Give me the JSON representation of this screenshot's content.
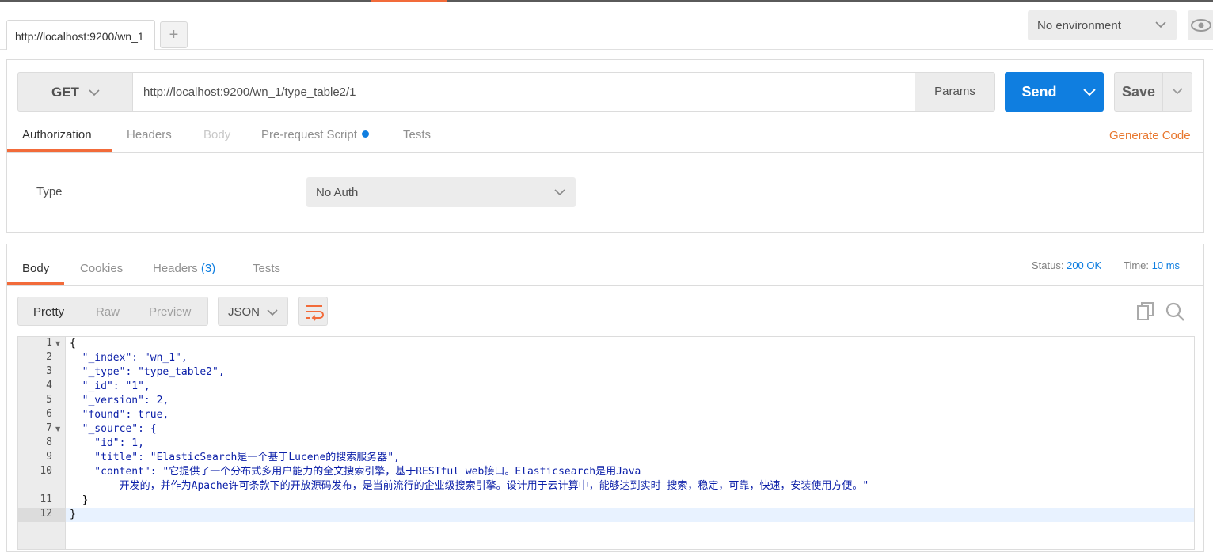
{
  "tabs": {
    "active_label": "http://localhost:9200/wn_1",
    "add_label": "+"
  },
  "environment": {
    "selected": "No environment"
  },
  "request": {
    "method": "GET",
    "url": "http://localhost:9200/wn_1/type_table2/1",
    "params_label": "Params",
    "send_label": "Send",
    "save_label": "Save",
    "tabs": [
      "Authorization",
      "Headers",
      "Body",
      "Pre-request Script",
      "Tests"
    ],
    "generate_code_label": "Generate Code",
    "auth_type_label": "Type",
    "auth_type_value": "No Auth"
  },
  "response": {
    "tabs": {
      "body": "Body",
      "cookies": "Cookies",
      "headers": "Headers",
      "headers_count": "(3)",
      "tests": "Tests"
    },
    "status_label": "Status:",
    "status_value": "200 OK",
    "time_label": "Time:",
    "time_value": "10 ms",
    "view_modes": [
      "Pretty",
      "Raw",
      "Preview"
    ],
    "format": "JSON"
  },
  "editor": {
    "line_numbers": [
      "1",
      "2",
      "3",
      "4",
      "5",
      "6",
      "7",
      "8",
      "9",
      "10",
      "",
      "11",
      "12"
    ],
    "lines": [
      "{",
      "  \"_index\": \"wn_1\",",
      "  \"_type\": \"type_table2\",",
      "  \"_id\": \"1\",",
      "  \"_version\": 2,",
      "  \"found\": true,",
      "  \"_source\": {",
      "    \"id\": 1,",
      "    \"title\": \"ElasticSearch是一个基于Lucene的搜索服务器\",",
      "    \"content\": \"它提供了一个分布式多用户能力的全文搜索引擎，基于RESTful web接口。Elasticsearch是用Java",
      "        开发的，并作为Apache许可条款下的开放源码发布，是当前流行的企业级搜索引擎。设计用于云计算中，能够达到实时 搜索，稳定，可靠，快速，安装使用方便。\"",
      "  }",
      "}"
    ]
  },
  "colors": {
    "accent_orange": "#f26b3a",
    "send_blue": "#0f7ee0",
    "generate_code_orange": "#e8772e",
    "json_string_blue": "#0b1fa8"
  },
  "icons": [
    "chevron-down-icon",
    "eye-icon",
    "wrap-lines-icon",
    "copy-icon",
    "search-icon",
    "fold-arrow-icon"
  ]
}
